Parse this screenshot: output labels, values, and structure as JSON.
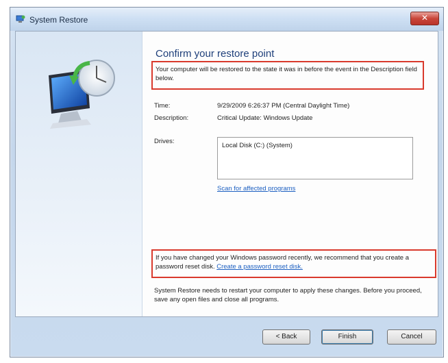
{
  "window": {
    "title": "System Restore",
    "close_glyph": "✕",
    "title_icon": "system-restore-icon"
  },
  "main": {
    "heading": "Confirm your restore point",
    "intro": "Your computer will be restored to the state it was in before the event in the Description field below.",
    "time_label": "Time:",
    "time_value": "9/29/2009 6:26:37 PM (Central Daylight Time)",
    "description_label": "Description:",
    "description_value": "Critical Update: Windows Update",
    "drives_label": "Drives:",
    "drives": [
      "Local Disk (C:) (System)"
    ],
    "scan_link": "Scan for affected programs",
    "password_warning": "If you have changed your Windows password recently, we recommend that you create a password reset disk.",
    "password_link": "Create a password reset disk.",
    "restart_note": "System Restore needs to restart your computer to apply these changes. Before you proceed, save any open files and close all programs."
  },
  "buttons": {
    "back": "< Back",
    "finish": "Finish",
    "cancel": "Cancel"
  },
  "colors": {
    "highlight_border": "#d9392c",
    "link": "#1c5fc1",
    "heading": "#1e3f7a"
  }
}
